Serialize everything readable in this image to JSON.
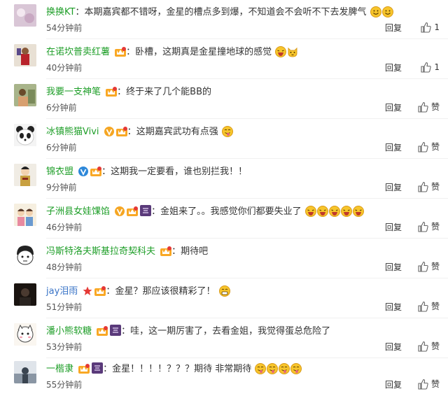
{
  "comments": [
    {
      "user": "换换KT",
      "text": "本期嘉宾都不错呀，金星的槽点多到爆，不知道会不会听不下去发脾气",
      "time": "54分钟前",
      "reply": "回复",
      "like": "1"
    },
    {
      "user": "在诺坎普卖红薯",
      "text": "卧槽，这期真是金星撞地球的感觉",
      "time": "40分钟前",
      "reply": "回复",
      "like": "1"
    },
    {
      "user": "我要一支神笔",
      "text": "终于来了几个能BB的",
      "time": "6分钟前",
      "reply": "回复",
      "like": "赞"
    },
    {
      "user": "冰镇熊猫Vivi",
      "text": "这期嘉宾武功有点强",
      "time": "6分钟前",
      "reply": "回复",
      "like": "赞"
    },
    {
      "user": "锦衣盟",
      "text": "这期我一定要看，谁也别拦我！！",
      "time": "9分钟前",
      "reply": "回复",
      "like": "赞"
    },
    {
      "user": "子洲县女娃馃馅",
      "text": "金姐来了。。我感觉你们都要失业了",
      "time": "46分钟前",
      "reply": "回复",
      "like": "赞"
    },
    {
      "user": "冯斯特洛夫斯基拉奇契科夫",
      "text": "期待吧",
      "time": "48分钟前",
      "reply": "回复",
      "like": "赞"
    },
    {
      "user": "jay泪雨",
      "text": "金星？那应该很精彩了！",
      "time": "51分钟前",
      "reply": "回复",
      "like": "赞"
    },
    {
      "user": "潘小熊软糖",
      "text": "哇，这一期厉害了，去看金姐，我觉得蛋总危险了",
      "time": "53分钟前",
      "reply": "回复",
      "like": "赞"
    },
    {
      "user": "一楷隶",
      "text": "金星！！！！？？？期待 非常期待",
      "time": "55分钟前",
      "reply": "回复",
      "like": "赞"
    }
  ],
  "colon": "：",
  "colors": {
    "username_green": "#1e9e28",
    "username_blue": "#3a74c7",
    "emoji_yellow": "#f7c52b"
  },
  "icons": [
    "thumbs-up-icon",
    "vip-crown-badge",
    "verified-v-icon",
    "member-badge",
    "emoji-icon"
  ]
}
